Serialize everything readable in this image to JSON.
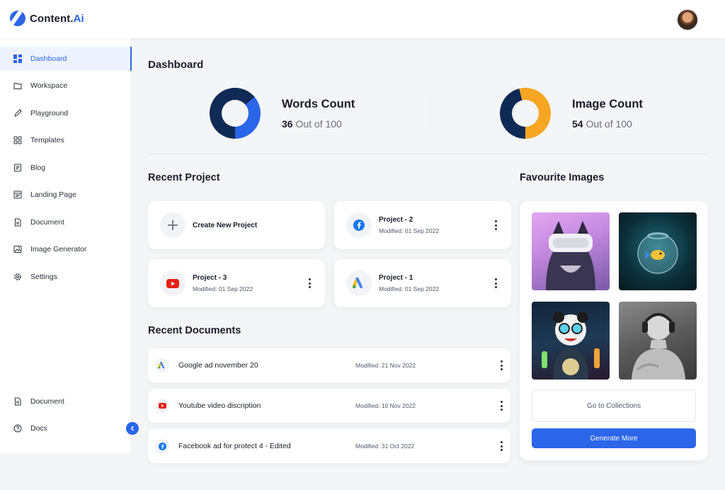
{
  "app": {
    "logo_main": "Content.",
    "logo_accent": "Ai"
  },
  "sidebar": {
    "items": [
      {
        "label": "Dashboard",
        "icon": "grid-icon",
        "active": true
      },
      {
        "label": "Workspace",
        "icon": "folder-icon"
      },
      {
        "label": "Playground",
        "icon": "pencil-icon"
      },
      {
        "label": "Templates",
        "icon": "templates-icon"
      },
      {
        "label": "Blog",
        "icon": "blog-icon"
      },
      {
        "label": "Landing Page",
        "icon": "landing-page-icon"
      },
      {
        "label": "Document",
        "icon": "document-icon"
      },
      {
        "label": "Image Generator",
        "icon": "image-icon"
      },
      {
        "label": "Settings",
        "icon": "gear-icon"
      }
    ],
    "bottom_items": [
      {
        "label": "Document",
        "icon": "document-icon"
      },
      {
        "label": "Docs",
        "icon": "help-icon"
      }
    ]
  },
  "dashboard": {
    "title": "Dashboard",
    "words": {
      "title": "Words Count",
      "value": "36",
      "suffix": "Out of 100",
      "fraction": 0.36,
      "color": "#2b65e8",
      "track": "#0f2a55"
    },
    "images": {
      "title": "Image Count",
      "value": "54",
      "suffix": "Out of 100",
      "fraction": 0.54,
      "color": "#f6a623",
      "track": "#0f2a55"
    }
  },
  "recent_project": {
    "title": "Recent Project",
    "create_label": "Create New Project",
    "projects": [
      {
        "name": "Project - 2",
        "modified": "Modified: 01 Sep 2022",
        "icon": "facebook-icon"
      },
      {
        "name": "Project - 3",
        "modified": "Modified: 01 Sep 2022",
        "icon": "youtube-icon"
      },
      {
        "name": "Project - 1",
        "modified": "Modified: 01 Sep 2022",
        "icon": "google-ads-icon"
      }
    ]
  },
  "recent_documents": {
    "title": "Recent Documents",
    "docs": [
      {
        "name": "Google ad november 20",
        "modified": "Modified: 21 Nov 2022",
        "icon": "google-ads-icon"
      },
      {
        "name": "Youtube video discription",
        "modified": "Modified: 10 Nov 2022",
        "icon": "youtube-icon"
      },
      {
        "name": "Facebook ad for protect 4 - Edited",
        "modified": "Modified: 31 Oct 2022",
        "icon": "facebook-icon"
      }
    ]
  },
  "favourite_images": {
    "title": "Favourite Images",
    "collections_label": "Go to Collections",
    "generate_label": "Generate More"
  }
}
